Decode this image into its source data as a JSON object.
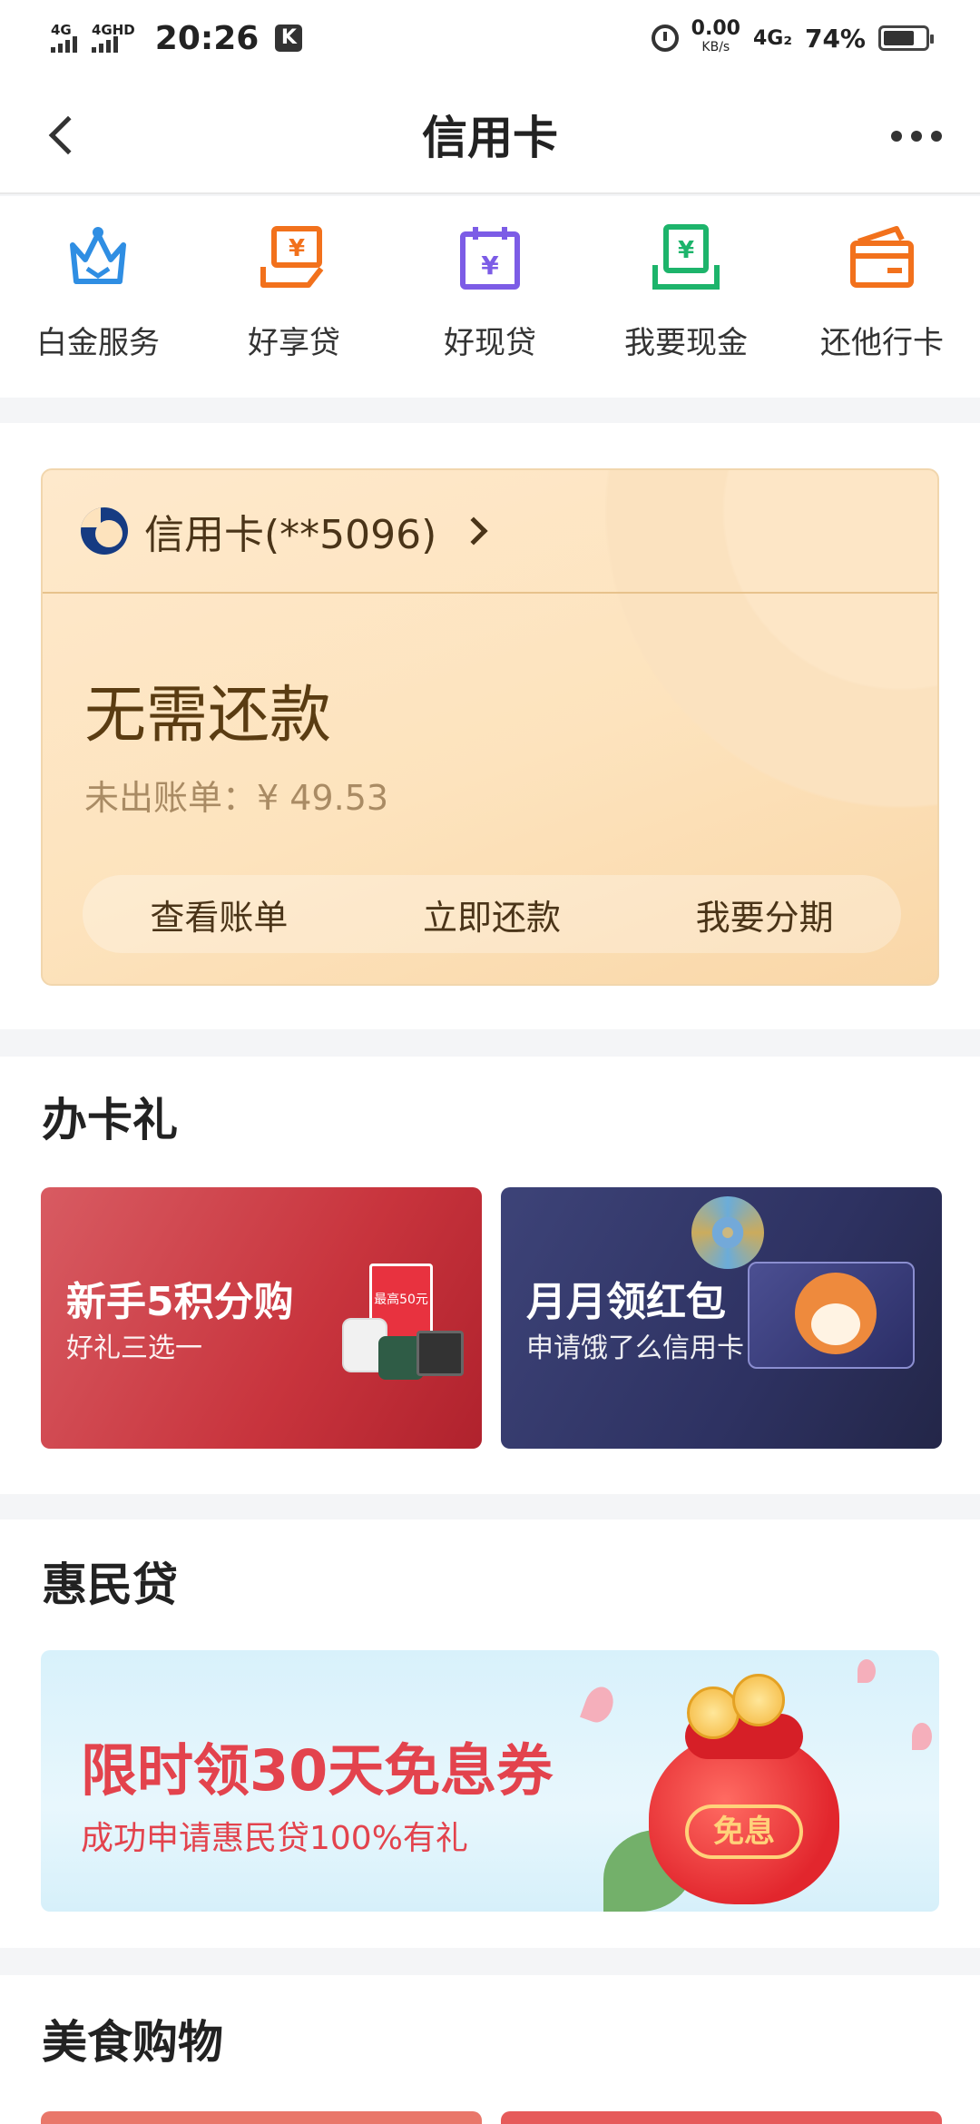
{
  "status_bar": {
    "net1": "4G",
    "net2": "4GHD",
    "time": "20:26",
    "k_badge": "K",
    "speed_value": "0.00",
    "speed_unit": "KB/s",
    "net3": "4G₂",
    "battery": "74%",
    "battery_level": 0.74
  },
  "header": {
    "title": "信用卡"
  },
  "quick_actions": [
    {
      "label": "白金服务",
      "icon": "crown-icon",
      "color": "#2f8ee3"
    },
    {
      "label": "好享贷",
      "icon": "yuan-hand-icon",
      "color": "#f2711c"
    },
    {
      "label": "好现贷",
      "icon": "yuan-calendar-icon",
      "color": "#7c5ce6"
    },
    {
      "label": "我要现金",
      "icon": "yuan-cash-icon",
      "color": "#1db46b"
    },
    {
      "label": "还他行卡",
      "icon": "card-icon",
      "color": "#f2711c"
    }
  ],
  "credit_card": {
    "name": "信用卡(**5096)",
    "status": "无需还款",
    "unbilled": "未出账单：¥ 49.53",
    "actions": [
      "查看账单",
      "立即还款",
      "我要分期"
    ]
  },
  "gift_section": {
    "title": "办卡礼",
    "promos": [
      {
        "title": "新手5积分购",
        "subtitle": "好礼三选一",
        "badge": "最高50元"
      },
      {
        "title": "月月领红包",
        "subtitle": "申请饿了么信用卡"
      }
    ]
  },
  "loan_section": {
    "title": "惠民贷",
    "banner_title": "限时领30天免息券",
    "banner_sub": "成功申请惠民贷100%有礼",
    "pouch_label": "免息"
  },
  "food_section": {
    "title": "美食购物"
  }
}
